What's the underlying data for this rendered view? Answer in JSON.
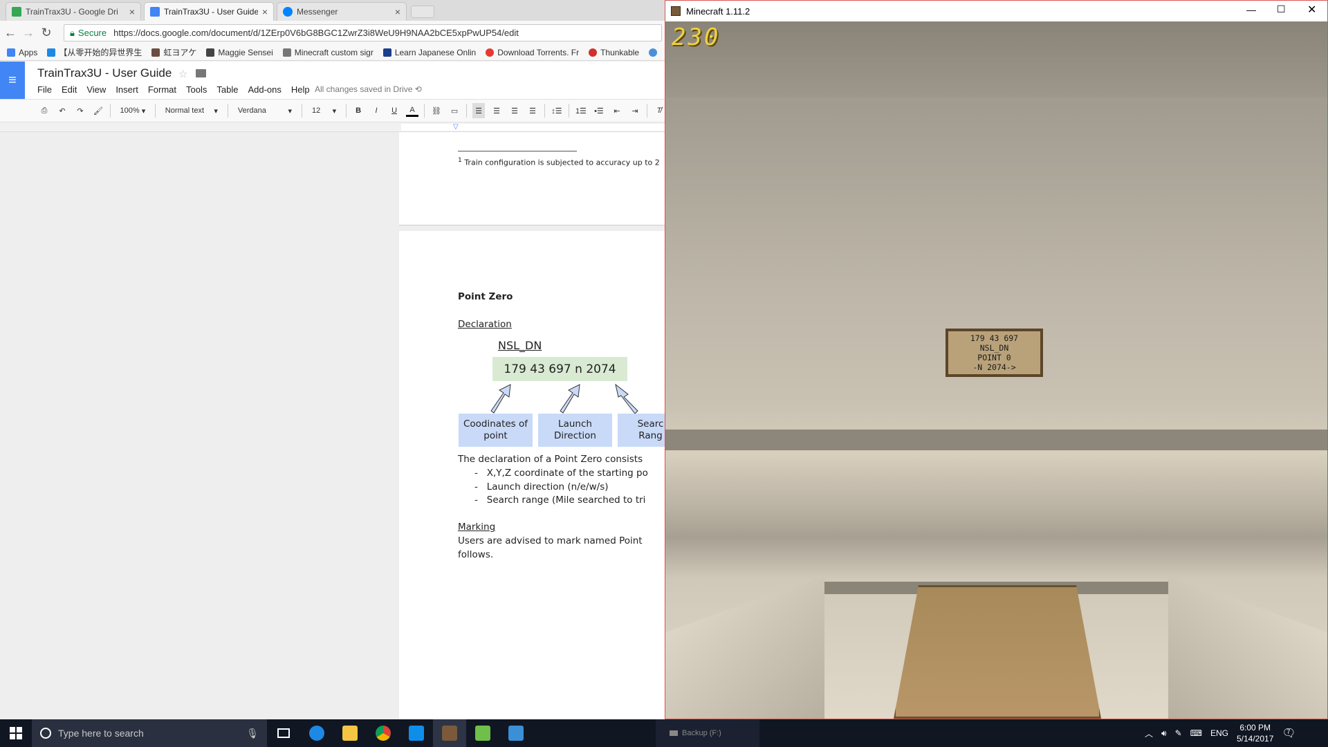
{
  "browser": {
    "tabs": [
      {
        "label": "TrainTrax3U - Google Dri",
        "icon": "google-drive-icon",
        "color": "#34a853"
      },
      {
        "label": "TrainTrax3U - User Guide",
        "icon": "google-docs-icon",
        "color": "#4285f4"
      },
      {
        "label": "Messenger",
        "icon": "messenger-icon",
        "color": "#0084ff"
      }
    ],
    "secure_label": "Secure",
    "url": "https://docs.google.com/document/d/1ZErp0V6bG8BGC1ZwrZ3i8WeU9H9NAA2bCE5xpPwUP54/edit",
    "bookmarks": [
      "Apps",
      "【从零开始的异世界生",
      "虹ヨアケ",
      "Maggie Sensei",
      "Minecraft custom sigr",
      "Learn Japanese Onlin",
      "Download Torrents. Fr",
      "Thunkable"
    ]
  },
  "docs": {
    "title": "TrainTrax3U - User Guide",
    "menus": [
      "File",
      "Edit",
      "View",
      "Insert",
      "Format",
      "Tools",
      "Table",
      "Add-ons",
      "Help"
    ],
    "saved_status": "All changes saved in Drive",
    "toolbar": {
      "zoom": "100%",
      "style": "Normal text",
      "font": "Verdana",
      "size": "12"
    },
    "footnote": "Train configuration is subjected to accuracy up to 2",
    "footnote_mark": "1",
    "heading": "Point Zero",
    "declaration_label": "Declaration",
    "diagram": {
      "sign_name": "NSL_DN",
      "declaration": "179 43 697 n 2074",
      "boxes": [
        "Coodinates of point",
        "Launch Direction",
        "Searc Rang"
      ]
    },
    "body_intro": "The declaration of a Point Zero consists",
    "bullets": [
      "X,Y,Z coordinate of the starting po",
      "Launch direction (n/e/w/s)",
      "Search range (Mile searched to tri"
    ],
    "marking_label": "Marking",
    "marking_text_1": "Users are advised to mark named Point",
    "marking_text_2": "follows."
  },
  "minecraft": {
    "window_title": "Minecraft 1.11.2",
    "counter": "230",
    "sign_lines": [
      "179 43 697",
      "NSL_DN",
      "POINT 0",
      "-N 2074->"
    ]
  },
  "taskbar": {
    "search_placeholder": "Type here to search",
    "backup_label": "Backup (F:)",
    "language": "ENG",
    "time": "6:00 PM",
    "date": "5/14/2017",
    "notification_count": "7"
  }
}
